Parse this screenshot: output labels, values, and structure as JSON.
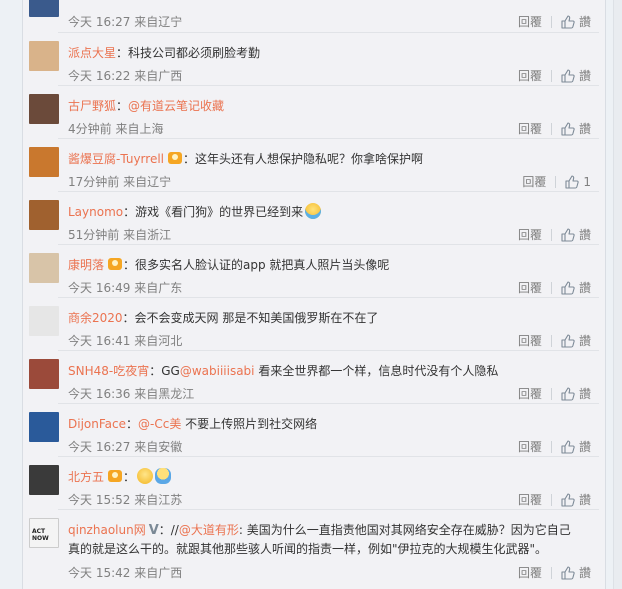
{
  "actions": {
    "reply": "回覆",
    "like": "讚"
  },
  "comments": [
    {
      "user": "",
      "badge": false,
      "vip": false,
      "parts": [],
      "time": "今天 16:27 来自辽宁",
      "likes": "讚",
      "avatar_color": "#3a5a8c"
    },
    {
      "user": "派点大星",
      "badge": false,
      "vip": false,
      "parts": [
        {
          "t": "txt",
          "v": "：科技公司都必须刷脸考勤"
        }
      ],
      "time": "今天 16:22 来自广西",
      "likes": "讚",
      "avatar_color": "#d9b38a"
    },
    {
      "user": "古尸野狐",
      "badge": false,
      "vip": false,
      "parts": [
        {
          "t": "txt",
          "v": "："
        },
        {
          "t": "at",
          "v": "@有道云笔记收藏"
        }
      ],
      "time": "4分钟前 来自上海",
      "likes": "讚",
      "avatar_color": "#6b4a3a"
    },
    {
      "user": "酱爆豆腐-Tuyrrell",
      "badge": true,
      "vip": false,
      "parts": [
        {
          "t": "txt",
          "v": "：这年头还有人想保护隐私呢？你拿啥保护啊"
        }
      ],
      "time": "17分钟前 来自辽宁",
      "likes": "1",
      "avatar_color": "#c9782e"
    },
    {
      "user": "Laynomo",
      "badge": false,
      "vip": false,
      "parts": [
        {
          "t": "txt",
          "v": "：游戏《看门狗》的世界已经到来"
        },
        {
          "t": "emo",
          "v": "laugh"
        }
      ],
      "time": "51分钟前 来自浙江",
      "likes": "讚",
      "avatar_color": "#a0612f"
    },
    {
      "user": "康明落",
      "badge": true,
      "vip": false,
      "parts": [
        {
          "t": "txt",
          "v": "：很多实名人脸认证的app 就把真人照片当头像呢"
        }
      ],
      "time": "今天 16:49 来自广东",
      "likes": "讚",
      "avatar_color": "#d8c4a8"
    },
    {
      "user": "商余2020",
      "badge": false,
      "vip": false,
      "parts": [
        {
          "t": "txt",
          "v": "：会不会变成天网 那是不知美国俄罗斯在不在了"
        }
      ],
      "time": "今天 16:41 来自河北",
      "likes": "讚",
      "avatar_color": "#e6e6e6"
    },
    {
      "user": "SNH48-吃夜宵",
      "badge": false,
      "vip": false,
      "parts": [
        {
          "t": "txt",
          "v": "：GG"
        },
        {
          "t": "at",
          "v": "@wabiiiisabi"
        },
        {
          "t": "txt",
          "v": " 看来全世界都一个样，信息时代没有个人隐私"
        }
      ],
      "time": "今天 16:36 来自黑龙江",
      "likes": "讚",
      "avatar_color": "#9b4a3a"
    },
    {
      "user": "DijonFace",
      "badge": false,
      "vip": false,
      "parts": [
        {
          "t": "txt",
          "v": "："
        },
        {
          "t": "at",
          "v": "@-Cc美"
        },
        {
          "t": "txt",
          "v": " 不要上传照片到社交网络"
        }
      ],
      "time": "今天 16:27 来自安徽",
      "likes": "讚",
      "avatar_color": "#2a5a9a"
    },
    {
      "user": "北方五",
      "badge": true,
      "vip": false,
      "parts": [
        {
          "t": "txt",
          "v": "："
        },
        {
          "t": "emo",
          "v": "smile"
        },
        {
          "t": "emo",
          "v": "hug"
        }
      ],
      "time": "今天 15:52 来自江苏",
      "likes": "讚",
      "avatar_color": "#3a3a3a"
    },
    {
      "user": "qinzhaolun网",
      "badge": false,
      "vip": true,
      "parts": [
        {
          "t": "txt",
          "v": "：//"
        },
        {
          "t": "at",
          "v": "@大道有形"
        },
        {
          "t": "txt",
          "v": ": 美国为什么一直指责他国对其网络安全存在威胁？因为它自己"
        }
      ],
      "line2": "真的就是这么干的。就跟其他那些骇人听闻的指责一样，例如\"伊拉克的大规模生化武器\"。",
      "time": "今天 15:42 来自广西",
      "likes": "讚",
      "avatar_color": "#f4f4f4",
      "avatar_text": "ACT NOW"
    }
  ],
  "vip_label": "V"
}
